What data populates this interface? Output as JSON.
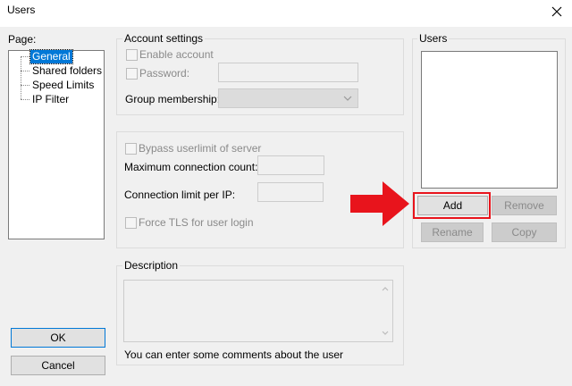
{
  "window": {
    "title": "Users"
  },
  "page_panel": {
    "label": "Page:",
    "items": [
      {
        "label": "General",
        "selected": true
      },
      {
        "label": "Shared folders",
        "selected": false
      },
      {
        "label": "Speed Limits",
        "selected": false
      },
      {
        "label": "IP Filter",
        "selected": false
      }
    ]
  },
  "account_settings": {
    "title": "Account settings",
    "enable_account": "Enable account",
    "password_label": "Password:",
    "password_value": "",
    "group_membership_label": "Group membership:",
    "group_membership_value": ""
  },
  "limits": {
    "bypass": "Bypass userlimit of server",
    "max_conn_label": "Maximum connection count:",
    "max_conn_value": "",
    "conn_per_ip_label": "Connection limit per IP:",
    "conn_per_ip_value": "",
    "force_tls": "Force TLS for user login"
  },
  "description": {
    "title": "Description",
    "value": "",
    "hint": "You can enter some comments about the user"
  },
  "users_panel": {
    "title": "Users",
    "items": [],
    "add": "Add",
    "remove": "Remove",
    "rename": "Rename",
    "copy": "Copy"
  },
  "dialog_buttons": {
    "ok": "OK",
    "cancel": "Cancel"
  },
  "annotation": {
    "highlight_color": "#e8141c"
  }
}
